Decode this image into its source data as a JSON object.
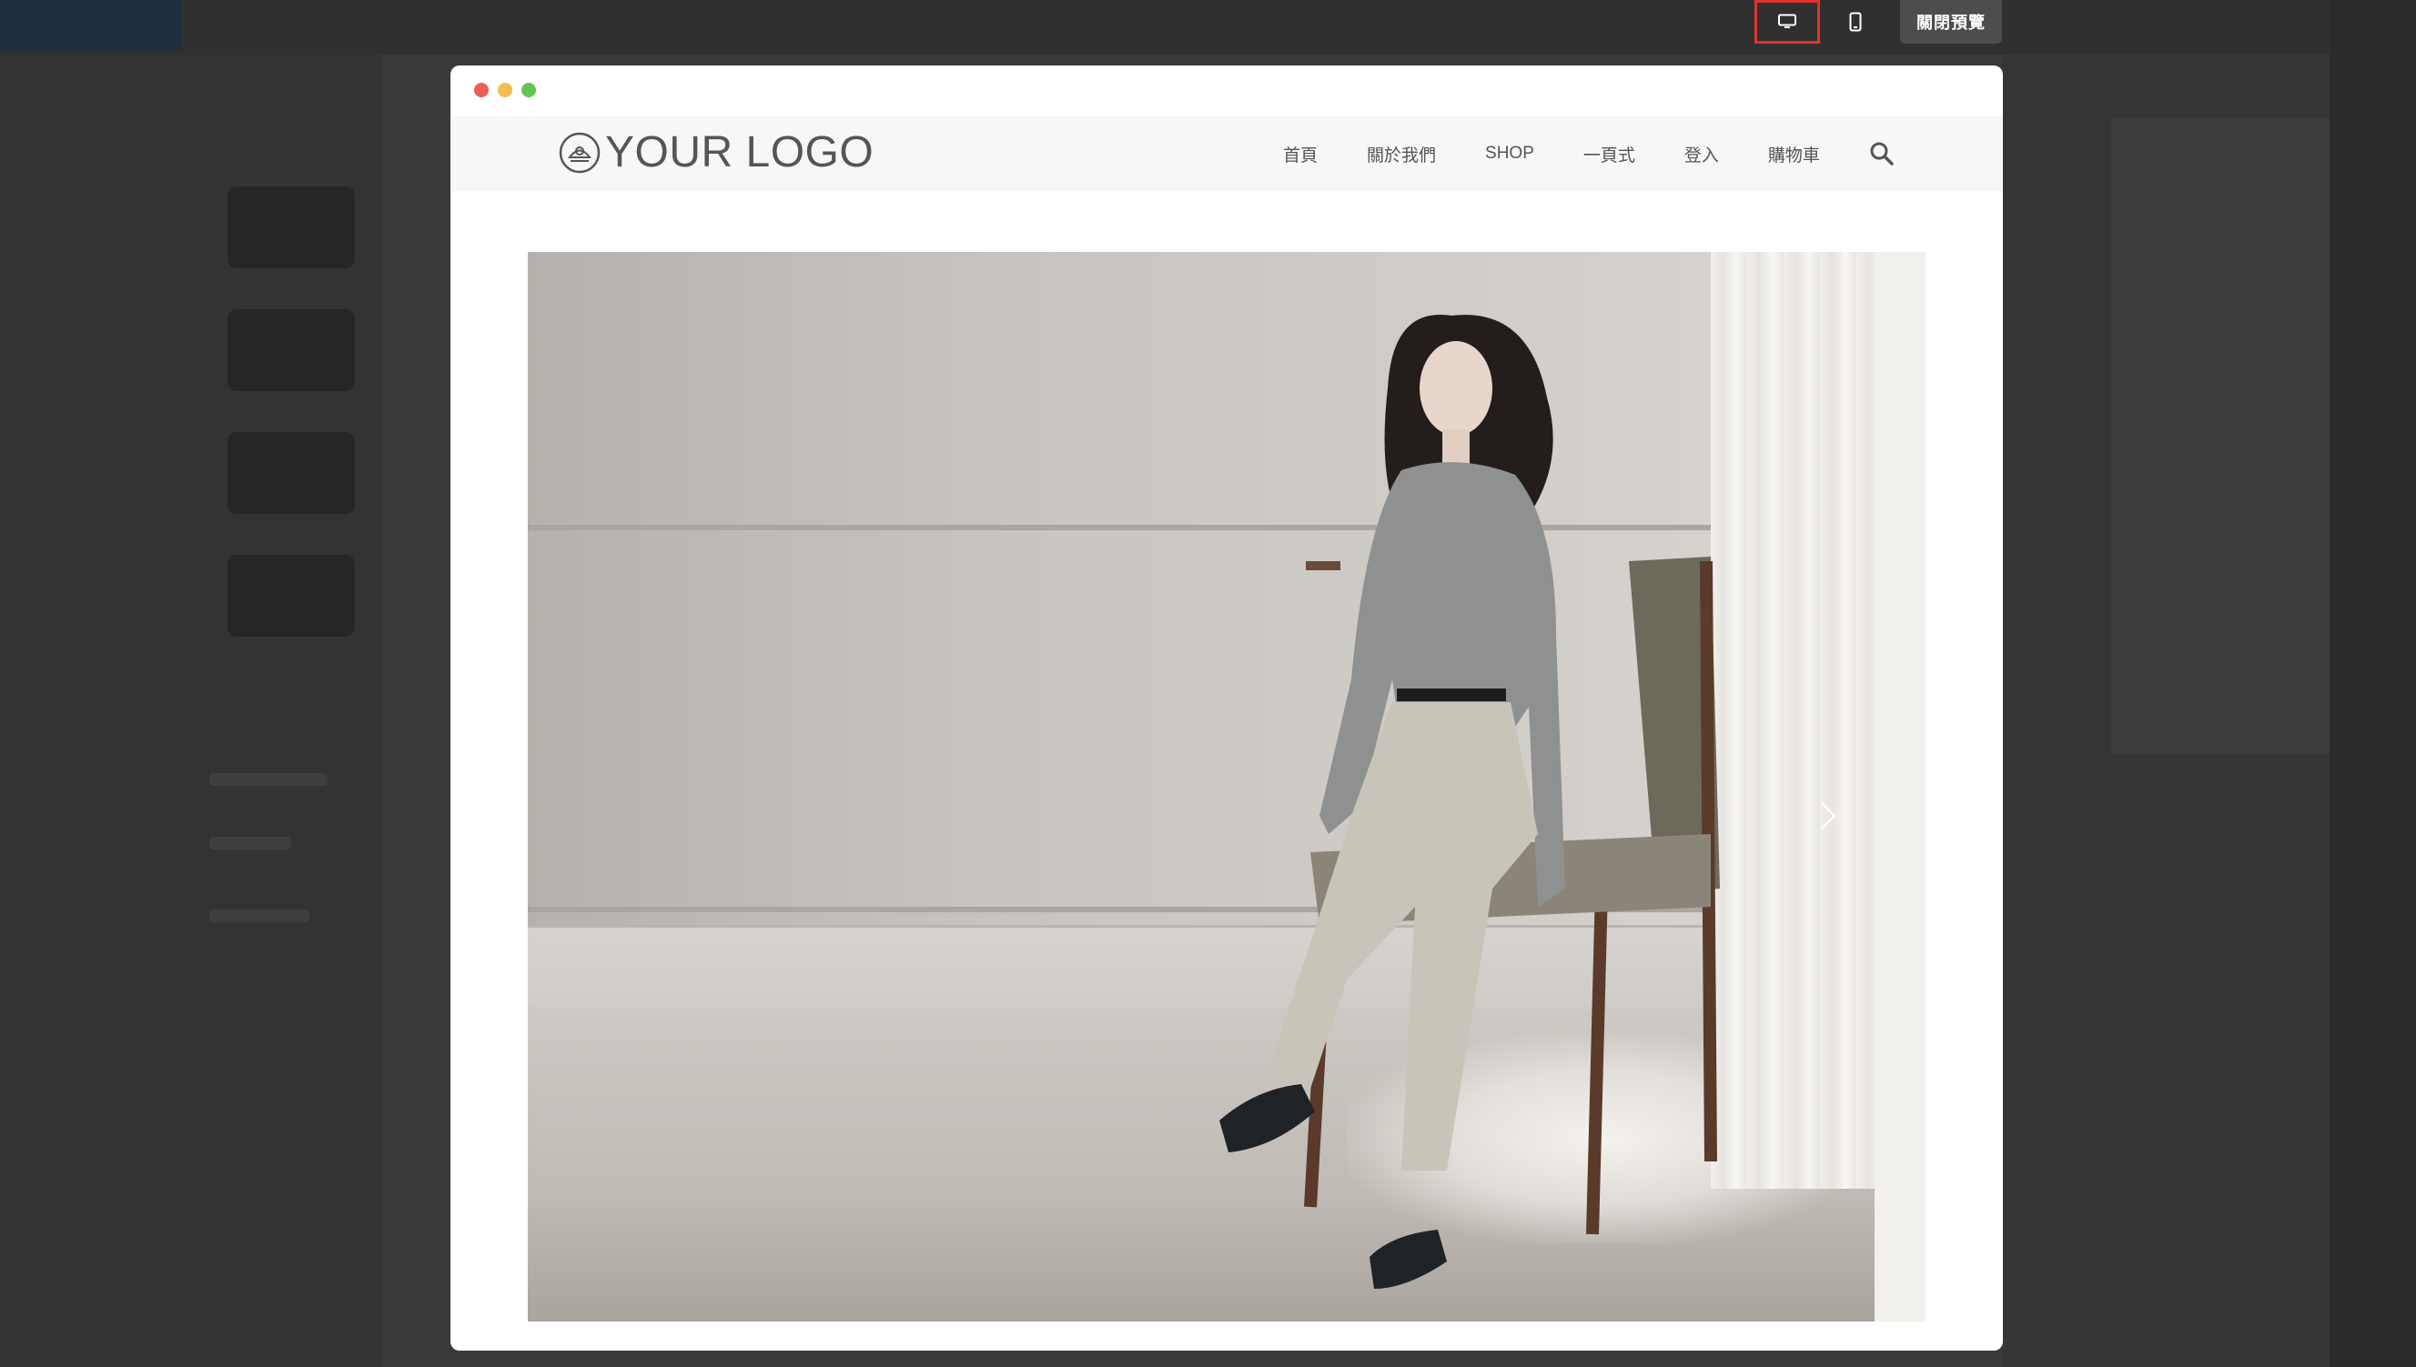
{
  "preview_controls": {
    "desktop_icon": "desktop-icon",
    "mobile_icon": "mobile-icon",
    "close_label": "關閉預覽",
    "active_mode": "desktop",
    "highlight_color": "#e0332b"
  },
  "window": {
    "traffic_lights": [
      "#ec5f57",
      "#f3be4f",
      "#63c554"
    ]
  },
  "site": {
    "logo_text": "YOUR LOGO",
    "nav": [
      {
        "label": "首頁"
      },
      {
        "label": "關於我們"
      },
      {
        "label": "SHOP"
      },
      {
        "label": "一頁式"
      },
      {
        "label": "登入"
      },
      {
        "label": "購物車"
      }
    ],
    "search_icon": "search-icon"
  },
  "hero": {
    "image_alt": "",
    "next_icon": "chevron-right-icon"
  }
}
